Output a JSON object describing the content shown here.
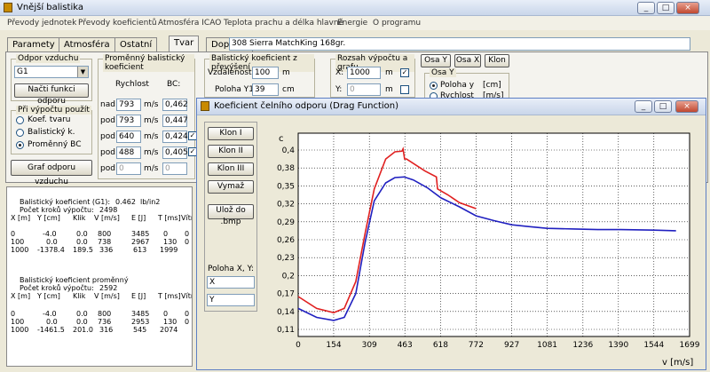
{
  "main_window": {
    "title": "Vnější balistika",
    "controls": {
      "minimize": "_",
      "maximize": "□",
      "close": "×"
    },
    "menu": [
      "Převody jednotek",
      "Převody koeficientů",
      "Atmosféra ICAO",
      "Teplota prachu a délka hlavně",
      "Energie",
      "O programu"
    ],
    "tabs": [
      "Paramety",
      "Atmosféra",
      "Ostatní",
      "Tvar",
      "Doplňky"
    ],
    "cartridge_name": "308 Sierra MatchKing 168gr.",
    "drag_group": {
      "title": "Odpor vzduchu",
      "select_value": "G1",
      "load_button": "Načti funkci odporu"
    },
    "use_group": {
      "title": "Při výpočtu použít",
      "options": [
        "Koef. tvaru",
        "Balistický k.",
        "Proměnný BC"
      ],
      "selected": 2
    },
    "graph_button": "Graf odporu vzduchu",
    "bc_group": {
      "title": "Proměnný balistický koeficient",
      "col_speed": "Rychlost",
      "col_bc": "BC:",
      "unit": "m/s",
      "rows": [
        {
          "label": "nad",
          "speed": "793",
          "bc": "0,462"
        },
        {
          "label": "pod",
          "speed": "793",
          "bc": "0,447"
        },
        {
          "label": "pod",
          "speed": "640",
          "bc": "0,424",
          "checked": "✓"
        },
        {
          "label": "pod",
          "speed": "488",
          "bc": "0,405",
          "checked": "✓"
        },
        {
          "label": "pod",
          "speed": "0",
          "bc": "0"
        }
      ]
    },
    "bc_slope_group": {
      "title": "Balistický koeficient z převýšení",
      "dist_label": "Vzdálenost1:",
      "dist_value": "100",
      "dist_unit": "m",
      "pos_label": "Poloha Y1:",
      "pos_value": "39",
      "pos_unit": "cm"
    },
    "range_group": {
      "title": "Rozsah výpočtu a grafu",
      "x_label": "X:",
      "x_value": "1000",
      "x_unit": "m",
      "x_check": "✓",
      "y_label": "Y:",
      "y_value": "0",
      "y_unit": "m"
    },
    "axis_buttons": [
      "Osa Y",
      "Osa X",
      "Klon"
    ],
    "osa_y_group": {
      "title": "Osa Y",
      "opt1": "Poloha y",
      "opt1_unit": "[cm]",
      "opt2": "Rychlost",
      "opt2_unit": "[m/s]"
    },
    "output": {
      "b1_title": "Balistický koeficient (G1):",
      "b1_value": "0.462",
      "b1_unit": "lb/in2",
      "b1_steps_label": "Počet kroků výpočtu:",
      "b1_steps": "2498",
      "headers": [
        "X [m]",
        "Y [cm]",
        "Klik",
        "V [m/s]",
        "E [J]",
        "T [ms]",
        "Vítr ["
      ],
      "b1_rows": [
        [
          "0",
          "-4.0",
          "0.0",
          "800",
          "3485",
          "0",
          "0"
        ],
        [
          "100",
          "0.0",
          "0.0",
          "738",
          "2967",
          "130",
          "0"
        ],
        [
          "1000",
          "-1378.4",
          "189.5",
          "336",
          "613",
          "1999",
          ""
        ]
      ],
      "b2_title": "Balistický koeficient proměnný",
      "b2_steps_label": "Počet kroků výpočtu:",
      "b2_steps": "2592",
      "b2_rows": [
        [
          "0",
          "-4.0",
          "0.0",
          "800",
          "3485",
          "0",
          "0"
        ],
        [
          "100",
          "0.0",
          "0.0",
          "736",
          "2953",
          "130",
          "0"
        ],
        [
          "1000",
          "-1461.5",
          "201.0",
          "316",
          "545",
          "2074",
          ""
        ]
      ]
    }
  },
  "drag_window": {
    "title": "Koeficient čelního odporu (Drag Function)",
    "buttons": [
      "Klon I",
      "Klon II",
      "Klon III",
      "Vymaž",
      "Ulož do .bmp"
    ],
    "pos_label": "Poloha X, Y:",
    "x_placeholder": "X",
    "y_placeholder": "Y"
  },
  "chart_data": {
    "type": "line",
    "ylabel": "c",
    "xlabel": "v [m/s]",
    "x_ticks": [
      0,
      154,
      309,
      463,
      618,
      772,
      927,
      1081,
      1236,
      1390,
      1544,
      1699
    ],
    "y_ticks": [
      0.11,
      0.14,
      0.17,
      0.2,
      0.23,
      0.26,
      0.29,
      0.32,
      0.35,
      0.38,
      0.41
    ],
    "y_tick_labels": [
      "0,11",
      "0,14",
      "0,17",
      "0,2",
      "0,23",
      "0,26",
      "0,29",
      "0,32",
      "0,35",
      "0,38",
      "0,4"
    ],
    "xlim": [
      0,
      1699
    ],
    "ylim": [
      0.11,
      0.41
    ],
    "grid": true,
    "series": [
      {
        "color": "#e02020",
        "x": [
          0,
          80,
          154,
          200,
          250,
          290,
          330,
          380,
          420,
          450,
          455,
          462,
          470,
          550,
          600,
          605,
          650,
          700,
          772
        ],
        "y": [
          0.165,
          0.145,
          0.138,
          0.145,
          0.19,
          0.27,
          0.345,
          0.395,
          0.407,
          0.408,
          0.412,
          0.395,
          0.395,
          0.375,
          0.365,
          0.345,
          0.335,
          0.322,
          0.312
        ]
      },
      {
        "color": "#2020c0",
        "x": [
          0,
          80,
          154,
          200,
          250,
          290,
          330,
          380,
          420,
          460,
          500,
          560,
          620,
          700,
          772,
          850,
          927,
          1000,
          1081,
          1200,
          1300,
          1400,
          1544,
          1640
        ],
        "y": [
          0.145,
          0.13,
          0.125,
          0.13,
          0.17,
          0.255,
          0.325,
          0.355,
          0.364,
          0.365,
          0.36,
          0.347,
          0.33,
          0.315,
          0.3,
          0.292,
          0.285,
          0.282,
          0.279,
          0.278,
          0.277,
          0.277,
          0.276,
          0.275
        ]
      }
    ]
  }
}
